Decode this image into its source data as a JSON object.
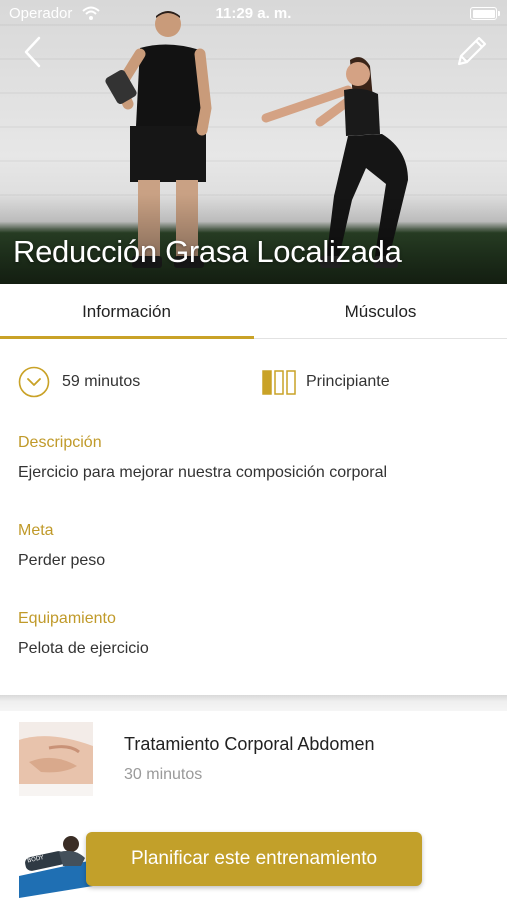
{
  "status_bar": {
    "carrier": "Operador",
    "time": "11:29 a. m."
  },
  "workout": {
    "title": "Reducción Grasa Localizada"
  },
  "tabs": [
    {
      "label": "Información"
    },
    {
      "label": "Músculos"
    }
  ],
  "info": {
    "duration": "59 minutos",
    "level": "Principiante",
    "sections": [
      {
        "label": "Descripción",
        "value": "Ejercicio para mejorar nuestra composición corporal"
      },
      {
        "label": "Meta",
        "value": "Perder peso"
      },
      {
        "label": "Equipamiento",
        "value": "Pelota de ejercicio"
      }
    ]
  },
  "exercises": [
    {
      "title": "Tratamiento Corporal Abdomen",
      "duration": "30 minutos"
    },
    {
      "title": "",
      "duration": ""
    }
  ],
  "cta": {
    "label": "Planificar este entrenamiento"
  },
  "colors": {
    "accent": "#c9a227",
    "button": "#c2a02a",
    "section_label": "#c09a2a"
  },
  "icons": [
    "back-chevron-icon",
    "edit-pencil-icon",
    "wifi-icon",
    "battery-icon",
    "clock-chevron-icon",
    "level-bars-icon"
  ]
}
